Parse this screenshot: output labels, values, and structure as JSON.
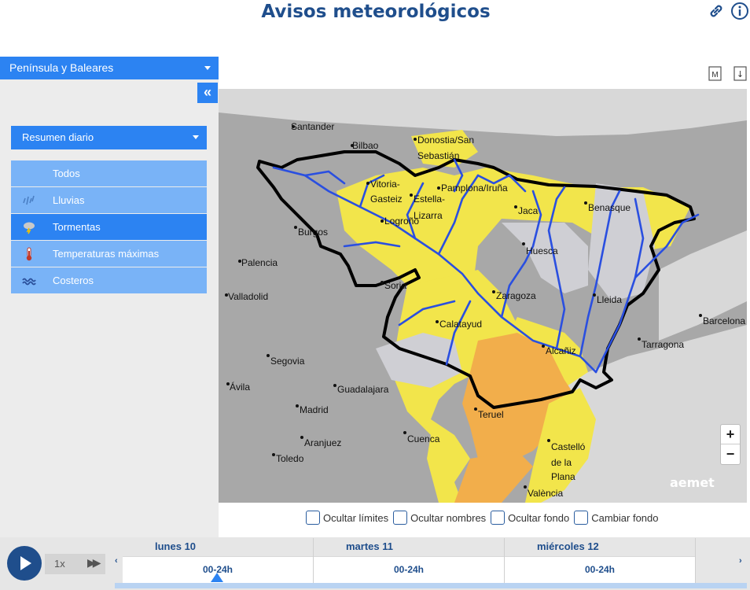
{
  "header": {
    "title": "Avisos meteorológicos"
  },
  "sidebar": {
    "region": "Península y Baleares",
    "collapse_label": "«",
    "mode": "Resumen diario",
    "items": [
      {
        "label": "Todos",
        "icon": "all-icon",
        "active": false
      },
      {
        "label": "Lluvias",
        "icon": "rain-icon",
        "active": false
      },
      {
        "label": "Tormentas",
        "icon": "storm-icon",
        "active": true
      },
      {
        "label": "Temperaturas máximas",
        "icon": "thermometer-icon",
        "active": false
      },
      {
        "label": "Costeros",
        "icon": "waves-icon",
        "active": false
      }
    ]
  },
  "map": {
    "cities": [
      "Santander",
      "Bilbao",
      "Donostia/San",
      "Sebastián",
      "Vitoria-",
      "Gasteiz",
      "Pamplona/Iruña",
      "Estella-",
      "Lizarra",
      "Logroño",
      "Jaca",
      "Benasque",
      "Burgos",
      "Palencia",
      "Huesca",
      "Soria",
      "Valladolid",
      "Zaragoza",
      "Lleida",
      "Barcelona",
      "Calatayud",
      "Tarragona",
      "Segovia",
      "Alcañiz",
      "Ávila",
      "Guadalajara",
      "Madrid",
      "Teruel",
      "Cuenca",
      "Aranjuez",
      "Castelló",
      "de la",
      "Plana",
      "Toledo",
      "València"
    ],
    "zoom_in": "+",
    "zoom_out": "−",
    "logo": "aemet",
    "tool_m": "M",
    "tool_download": "↓",
    "colors": {
      "yellow": "#f2e54b",
      "orange": "#f2ae4b",
      "no_warning": "#cfcfd4",
      "river": "#2a4fe0",
      "border": "#000000"
    }
  },
  "options": [
    {
      "label": "Ocultar límites"
    },
    {
      "label": "Ocultar nombres"
    },
    {
      "label": "Ocultar fondo"
    },
    {
      "label": "Cambiar fondo"
    }
  ],
  "player": {
    "speed": "1x",
    "fast_forward": "▶▶",
    "prev": "‹",
    "next": "›"
  },
  "timeline": {
    "days": [
      {
        "label": "lunes 10",
        "slot": "00-24h"
      },
      {
        "label": "martes 11",
        "slot": "00-24h"
      },
      {
        "label": "miércoles 12",
        "slot": "00-24h"
      }
    ],
    "selected_index": 0
  }
}
